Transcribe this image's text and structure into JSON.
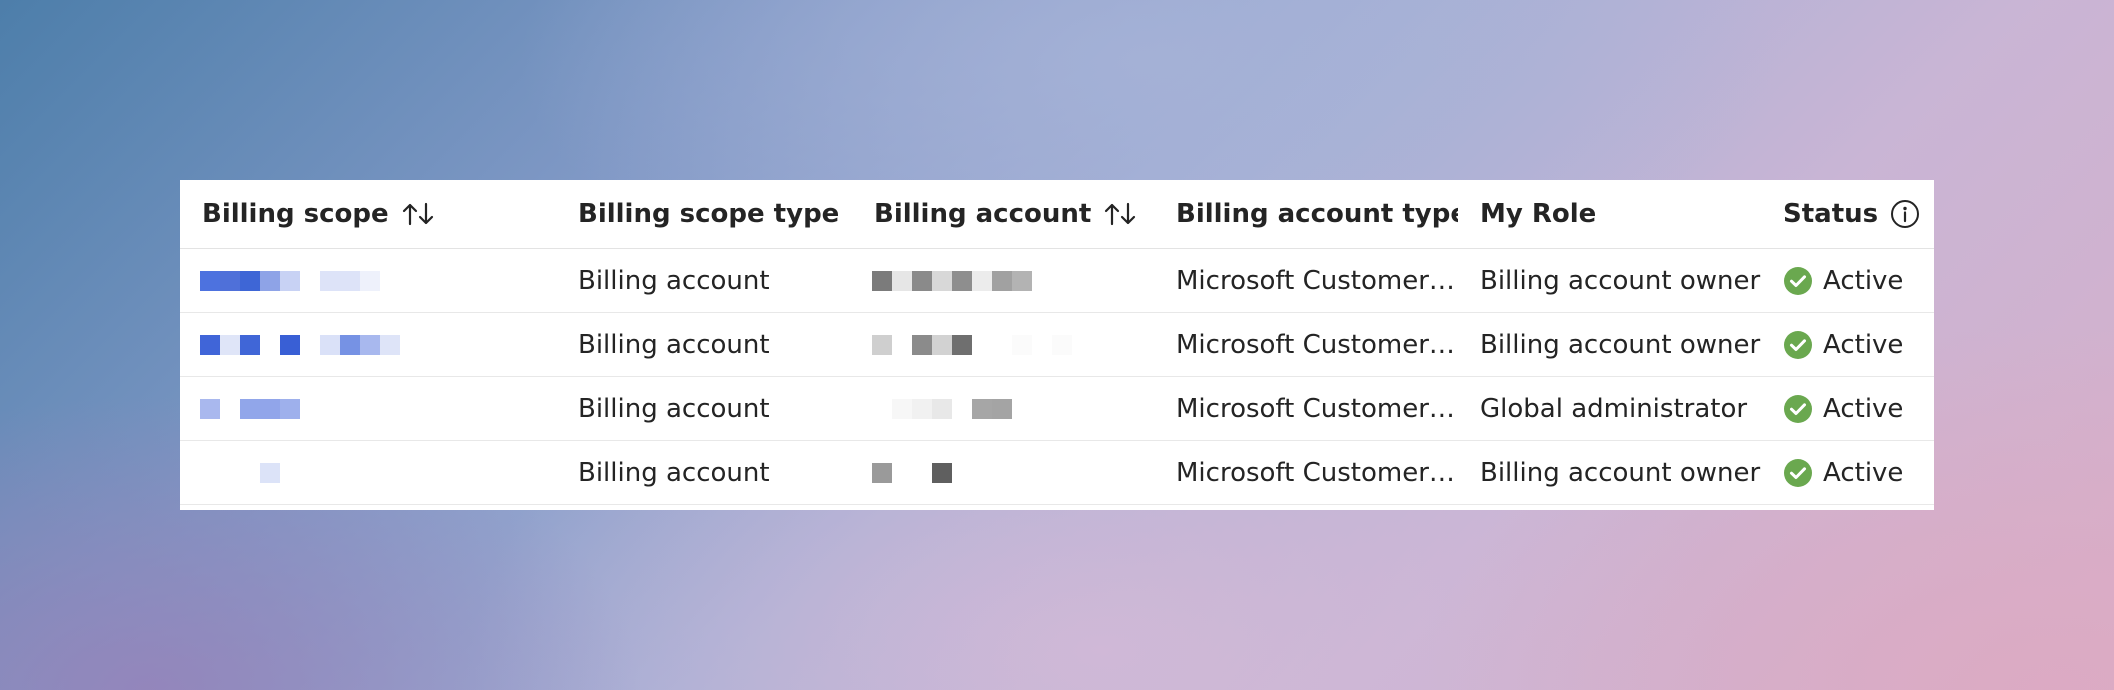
{
  "table": {
    "columns": [
      {
        "label": "Billing scope",
        "sortable": true
      },
      {
        "label": "Billing scope type",
        "sortable": true
      },
      {
        "label": "Billing account",
        "sortable": true
      },
      {
        "label": "Billing account type",
        "sortable": true
      },
      {
        "label": "My Role",
        "sortable": false
      },
      {
        "label": "Status",
        "sortable": false,
        "info": true
      }
    ],
    "rows": [
      {
        "scope_type": "Billing account",
        "account_type": "Microsoft Customer Ag...",
        "role": "Billing account owner",
        "status": "Active"
      },
      {
        "scope_type": "Billing account",
        "account_type": "Microsoft Customer Ag...",
        "role": "Billing account owner",
        "status": "Active"
      },
      {
        "scope_type": "Billing account",
        "account_type": "Microsoft Customer Ag...",
        "role": "Global administrator",
        "status": "Active"
      },
      {
        "scope_type": "Billing account",
        "account_type": "Microsoft Customer Ag...",
        "role": "Billing account owner",
        "status": "Active"
      }
    ]
  },
  "icons": {
    "sort": "sort-arrows-icon",
    "info": "info-circle-icon",
    "status": "check-circle-icon"
  },
  "colors": {
    "status_active": "#6aa84f",
    "link_redacted": "#4c6fdc",
    "text": "#242424",
    "divider": "#e6e6e6"
  }
}
